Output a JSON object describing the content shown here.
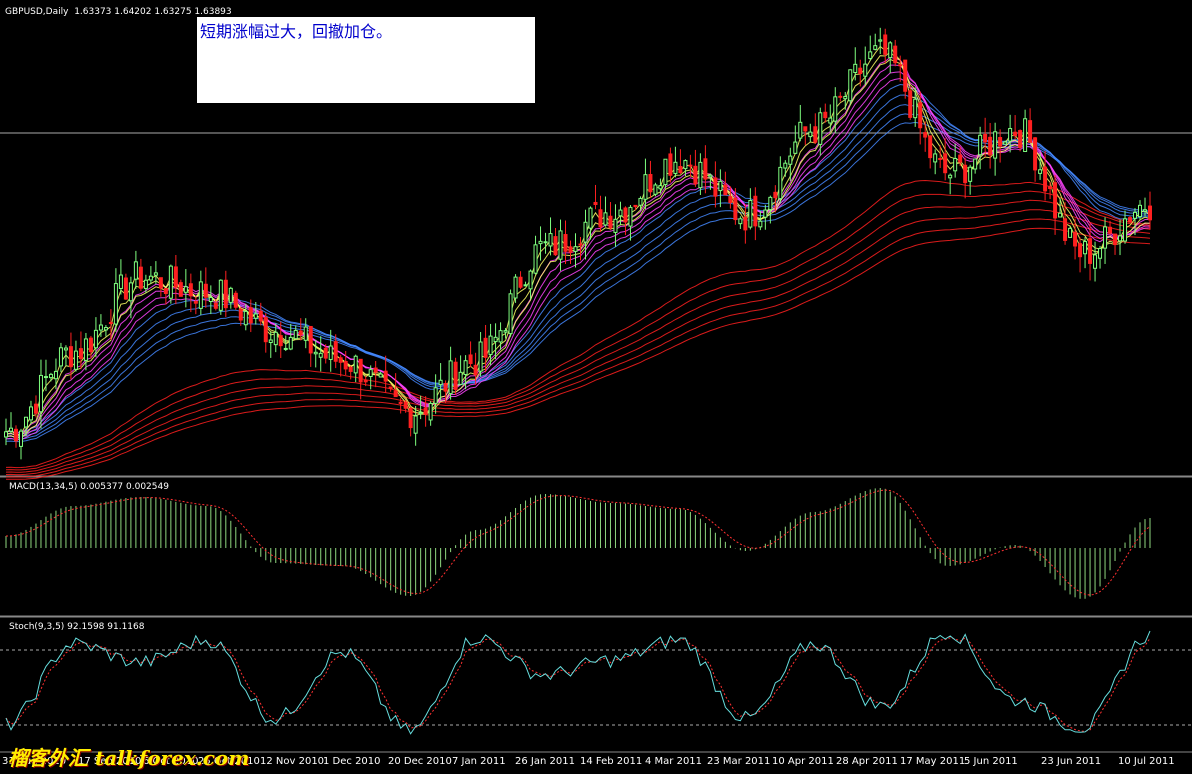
{
  "chart": {
    "symbol_label": "GBPUSD,Daily",
    "ohlc_text": "1.63373 1.64202 1.63275 1.63893",
    "annotation": "短期涨幅过大，回撤加仓。",
    "macd_label": "MACD(13,34,5) 0.005377 0.002549",
    "stoch_label": "Stoch(9,3,5) 92.1598 91.1168",
    "watermark": "榴客外汇 talkforex.com",
    "x_labels": [
      "31 Aug 2010",
      "17 Sep 2010",
      "6 Oct 2010",
      "25 Oct 2010",
      "12 Nov 2010",
      "1 Dec 2010",
      "20 Dec 2010",
      "7 Jan 2011",
      "26 Jan 2011",
      "14 Feb 2011",
      "4 Mar 2011",
      "23 Mar 2011",
      "10 Apr 2011",
      "28 Apr 2011",
      "17 May 2011",
      "5 Jun 2011",
      "23 Jun 2011",
      "10 Jul 2011"
    ]
  },
  "colors": {
    "bull": "#7fff7f",
    "bear": "#ff2020",
    "ema_fast": "#ffff66",
    "ema_mid": "#ff44ff",
    "ema_slow": "#4488ff",
    "ema_long": "#ff2020",
    "macd_hist": "#8fd87f",
    "macd_signal": "#ff3030",
    "stoch_main": "#66dddd",
    "stoch_signal": "#ff3030"
  },
  "chart_data": {
    "type": "line",
    "x": [
      "31 Aug 2010",
      "17 Sep 2010",
      "6 Oct 2010",
      "25 Oct 2010",
      "12 Nov 2010",
      "1 Dec 2010",
      "20 Dec 2010",
      "7 Jan 2011",
      "26 Jan 2011",
      "14 Feb 2011",
      "4 Mar 2011",
      "23 Mar 2011",
      "10 Apr 2011",
      "28 Apr 2011",
      "17 May 2011",
      "5 Jun 2011",
      "23 Jun 2011",
      "10 Jul 2011"
    ],
    "series": [
      {
        "values": [
          1.538,
          1.565,
          1.59,
          1.585,
          1.572,
          1.562,
          1.545,
          1.562,
          1.6,
          1.612,
          1.63,
          1.611,
          1.64,
          1.665,
          1.625,
          1.64,
          1.598,
          1.615
        ]
      },
      {
        "values": [
          0.2,
          0.7,
          0.85,
          0.7,
          -0.25,
          -0.3,
          -0.8,
          0.3,
          0.9,
          0.75,
          0.65,
          -0.05,
          0.6,
          1.0,
          -0.3,
          0.05,
          -0.85,
          0.5
        ]
      },
      {
        "values": [
          20,
          85,
          70,
          88,
          25,
          78,
          15,
          90,
          60,
          72,
          88,
          25,
          85,
          35,
          95,
          40,
          18,
          92
        ]
      }
    ]
  }
}
